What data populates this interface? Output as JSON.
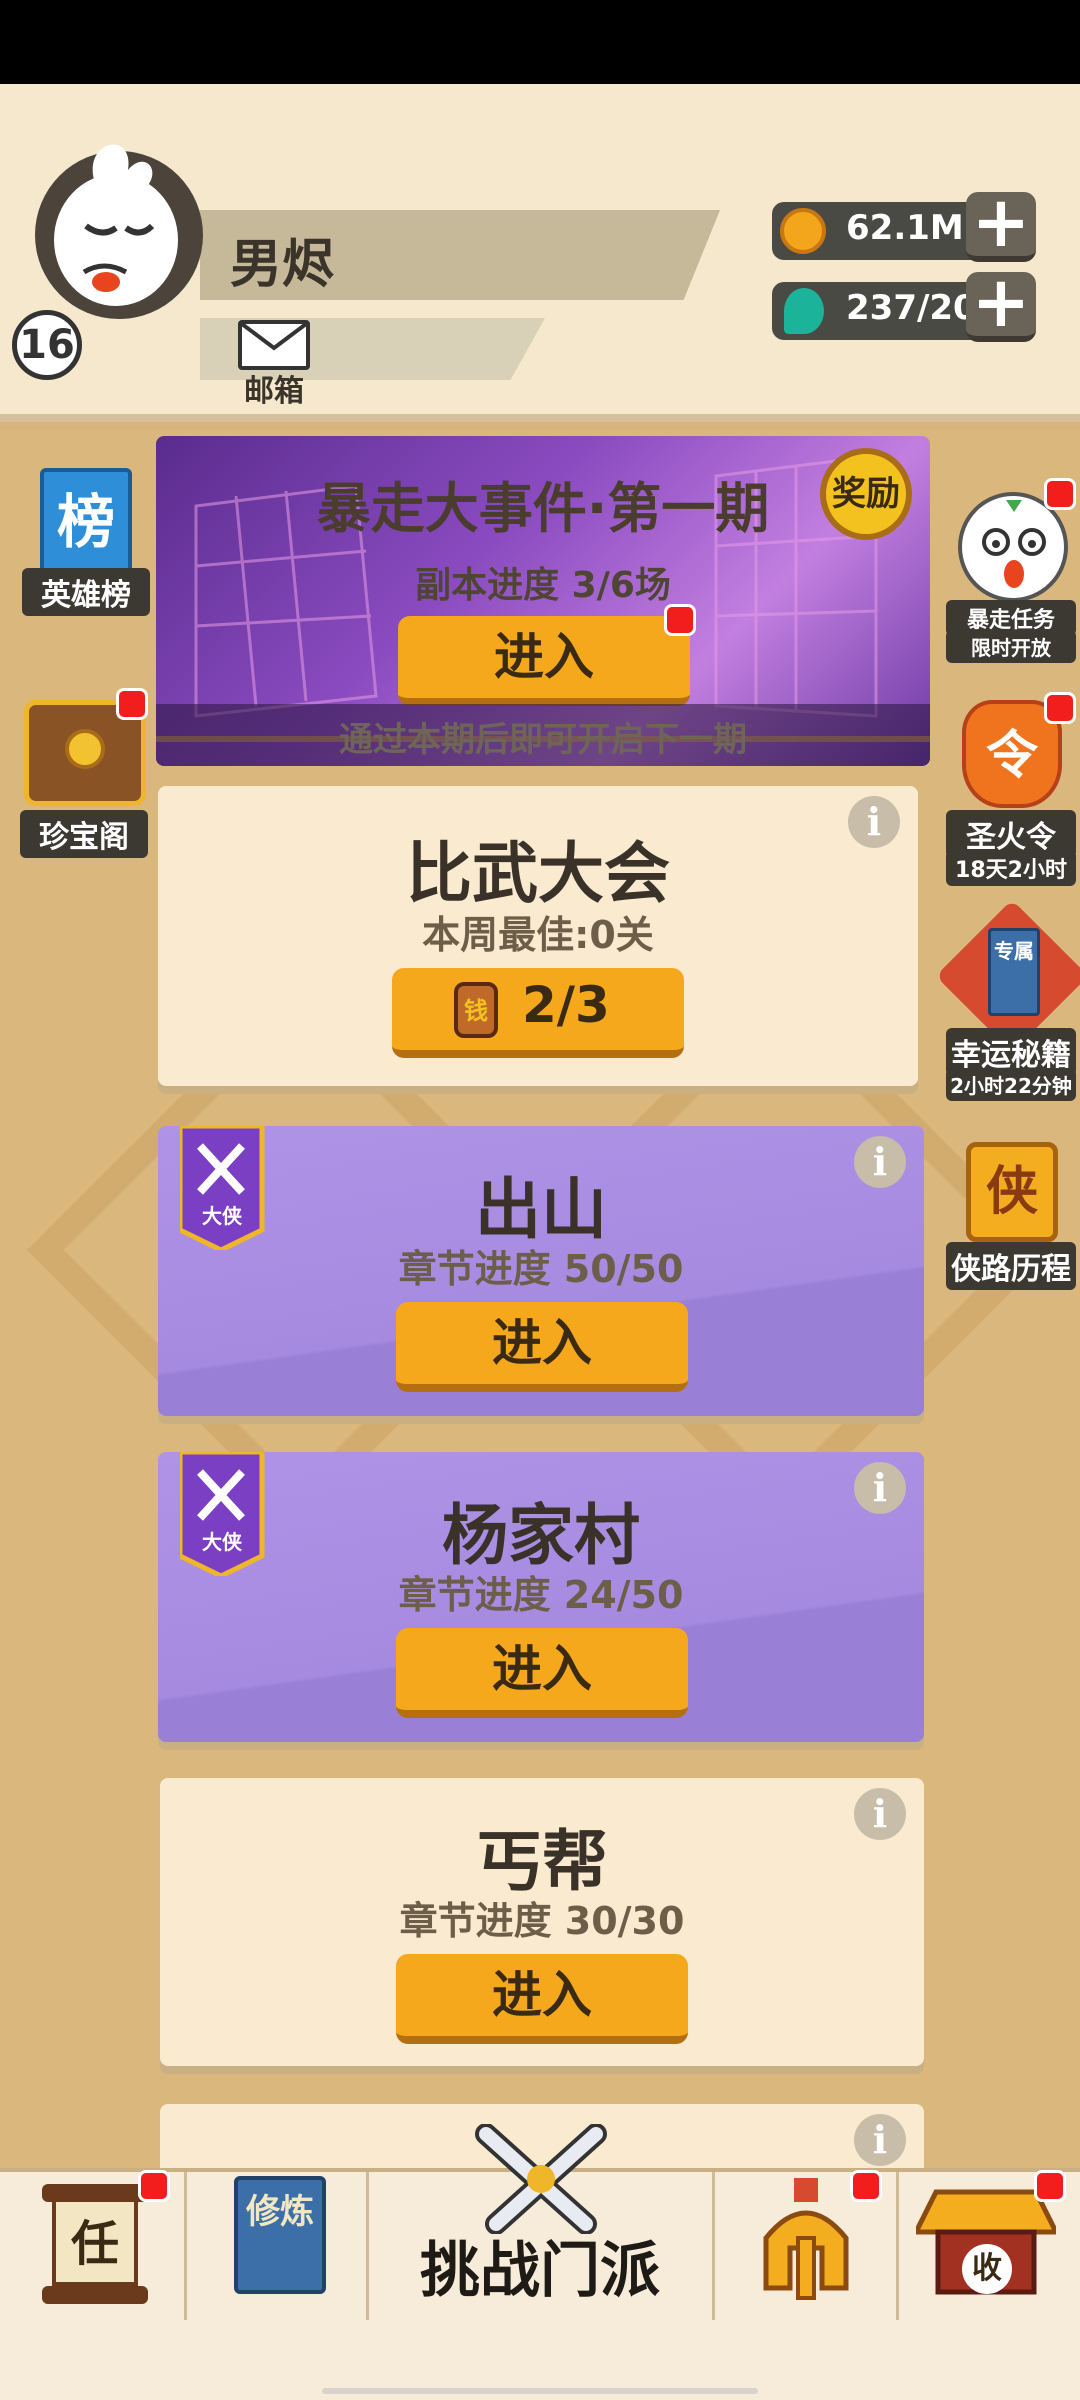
{
  "player": {
    "name": "男烬",
    "level": "16"
  },
  "mail": {
    "label": "邮箱"
  },
  "resources": {
    "coins": "62.1M",
    "gems": "237/20"
  },
  "side_left": [
    {
      "icon_text": "榜",
      "label": "英雄榜"
    },
    {
      "label": "珍宝阁"
    }
  ],
  "side_right": [
    {
      "label": "暴走任务",
      "sub": "限时开放"
    },
    {
      "icon_text": "令",
      "label": "圣火令",
      "sub": "18天2小时"
    },
    {
      "icon_text": "专属",
      "label": "幸运秘籍",
      "sub": "2小时22分钟"
    },
    {
      "icon_text": "侠",
      "label": "侠路历程"
    }
  ],
  "event": {
    "title": "暴走大事件·第一期",
    "reward_label": "奖励",
    "progress": "副本进度 3/6场",
    "enter_label": "进入",
    "note": "通过本期后即可开启下一期"
  },
  "arena": {
    "title": "比武大会",
    "best": "本周最佳:0关",
    "ticket_icon_text": "钱",
    "tickets": "2/3"
  },
  "stages": [
    {
      "badge_label": "大侠",
      "title": "出山",
      "progress": "章节进度 50/50",
      "enter_label": "进入"
    },
    {
      "badge_label": "大侠",
      "title": "杨家村",
      "progress": "章节进度 24/50",
      "enter_label": "进入"
    },
    {
      "title": "丐帮",
      "progress": "章节进度 30/30",
      "enter_label": "进入"
    }
  ],
  "info_symbol": "i",
  "bottom_nav": {
    "task_icon_text": "任",
    "cultivate_icon_text": "修炼",
    "challenge_label": "挑战门派",
    "collect_icon_text": "收"
  },
  "colors": {
    "accent_button": "#f5a81c",
    "notification": "#f21d1d",
    "purple_card": "#a58ae0",
    "cream_card": "#f9ead0"
  },
  "icons": [
    "avatar-icon",
    "mail-icon",
    "coin-icon",
    "gem-icon",
    "plus-icon",
    "ranking-flag-icon",
    "treasure-chest-icon",
    "mascot-icon",
    "flame-token-icon",
    "secret-book-icon",
    "hero-journey-icon",
    "info-icon",
    "crossed-swords-icon",
    "scroll-icon",
    "book-icon",
    "helmet-icon",
    "pavilion-icon"
  ]
}
